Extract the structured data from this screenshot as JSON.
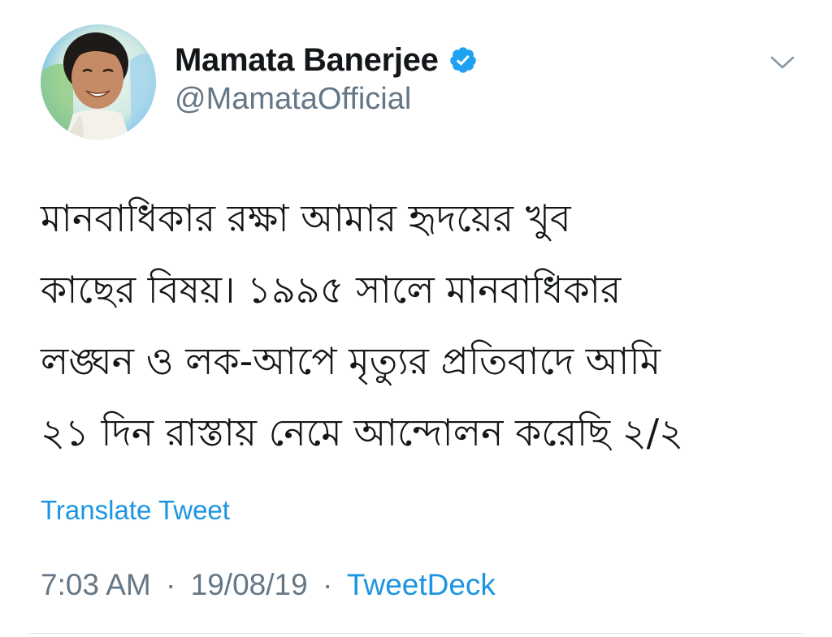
{
  "tweet": {
    "author": {
      "display_name": "Mamata Banerjee",
      "handle": "@MamataOfficial",
      "verified": true,
      "avatar_icon": "profile-photo"
    },
    "text": "মানবাধিকার রক্ষা আমার হৃদয়ের খুব\nকাছের বিষয়। ১৯৯৫ সালে মানবাধিকার\nলঙ্ঘন ও লক-আপে মৃত্যুর প্রতিবাদে আমি\n২১ দিন রাস্তায় নেমে আন্দোলন করেছি ২/২",
    "translate_label": "Translate Tweet",
    "time": "7:03 AM",
    "date": "19/08/19",
    "separator": "·",
    "source": "TweetDeck",
    "menu_icon": "chevron-down-icon"
  },
  "colors": {
    "text": "#14171a",
    "secondary": "#657786",
    "link": "#1b95e0",
    "verified_badge": "#1da1f2",
    "divider": "#e1e8ed"
  }
}
